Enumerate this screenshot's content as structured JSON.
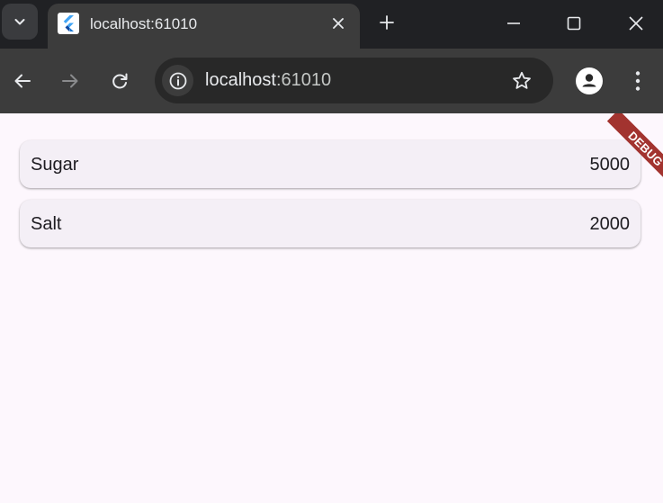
{
  "browser": {
    "tab": {
      "title": "localhost:61010",
      "favicon": "flutter-logo-icon"
    },
    "address_bar": {
      "host": "localhost",
      "port": ":61010"
    },
    "icons": {
      "tab_search": "chevron-down-icon",
      "close_tab": "close-icon",
      "new_tab": "plus-icon",
      "minimize": "minimize-icon",
      "maximize": "maximize-icon",
      "close_window": "close-icon",
      "back": "arrow-left-icon",
      "forward": "arrow-right-icon",
      "reload": "reload-icon",
      "site_info": "info-icon",
      "bookmark": "star-icon",
      "profile": "person-icon",
      "menu": "more-vert-icon"
    },
    "colors": {
      "titlebar": "#202124",
      "toolbar": "#3c3c3c",
      "omnibox": "#282828",
      "text": "#e8eaed"
    }
  },
  "app": {
    "items": [
      {
        "name": "Sugar",
        "value": "5000"
      },
      {
        "name": "Salt",
        "value": "2000"
      }
    ],
    "debug_banner": "DEBUG",
    "colors": {
      "background": "#fdf7fd",
      "card": "#f4eff6",
      "text": "#1d1b20",
      "debug_banner": "#a2332f"
    }
  }
}
